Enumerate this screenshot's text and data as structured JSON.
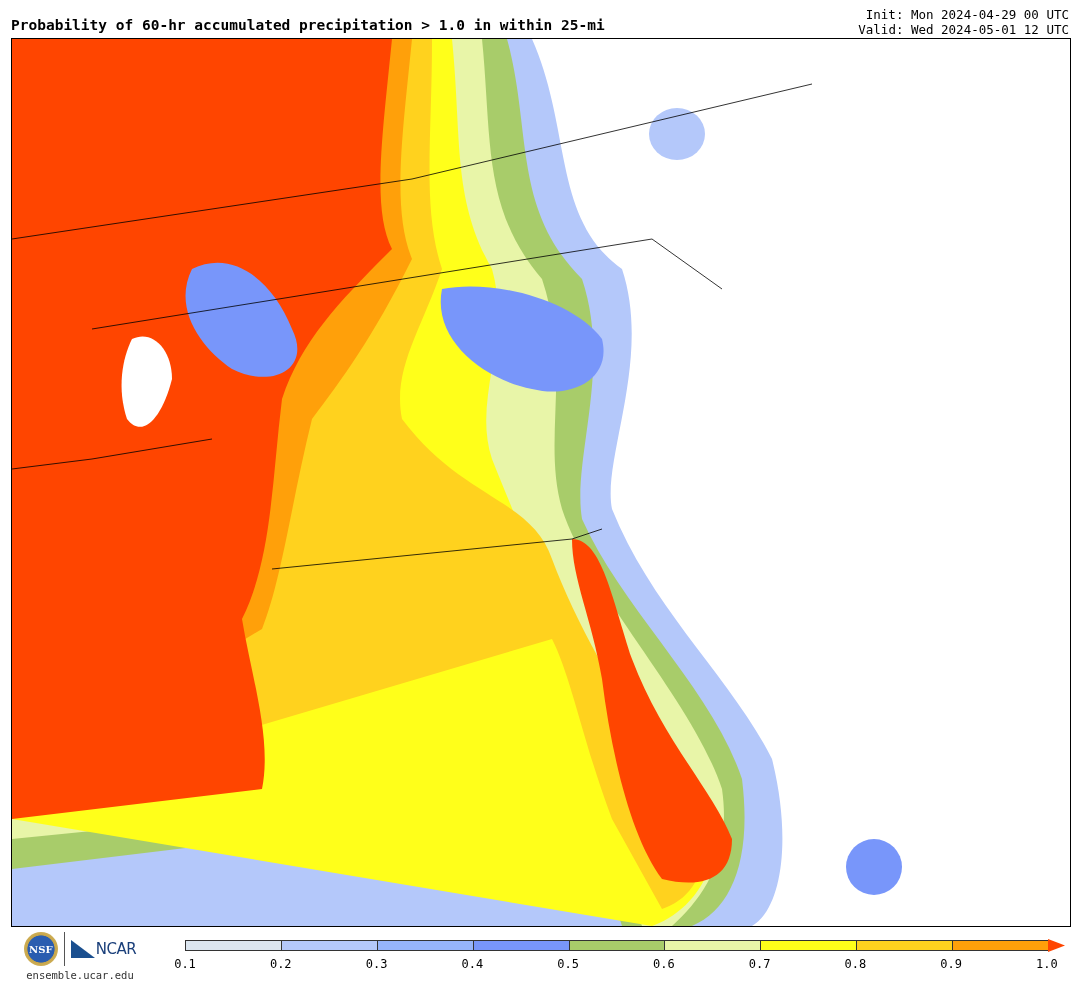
{
  "title": "Probability of 60-hr accumulated precipitation > 1.0 in within 25-mi",
  "init": "Init: Mon 2024-04-29 00 UTC",
  "valid": "Valid: Wed 2024-05-01 12 UTC",
  "logos": [
    {
      "kind": "seal",
      "text": "NSF"
    },
    {
      "kind": "wordmark",
      "text": "NCAR"
    }
  ],
  "site": "ensemble.ucar.edu",
  "colorbar": {
    "bins": [
      {
        "color": "#dce6f0"
      },
      {
        "color": "#b4c8fa"
      },
      {
        "color": "#96b4fa"
      },
      {
        "color": "#7896fa"
      },
      {
        "color": "#a8cc6a"
      },
      {
        "color": "#e8f5a8"
      },
      {
        "color": "#ffff1a"
      },
      {
        "color": "#ffd21e"
      },
      {
        "color": "#ffa00a"
      },
      {
        "kind": "arrow",
        "color": "#ff4500"
      }
    ],
    "ticks": [
      "0.1",
      "0.2",
      "0.3",
      "0.4",
      "0.5",
      "0.6",
      "0.7",
      "0.8",
      "0.9",
      "1.0"
    ]
  }
}
